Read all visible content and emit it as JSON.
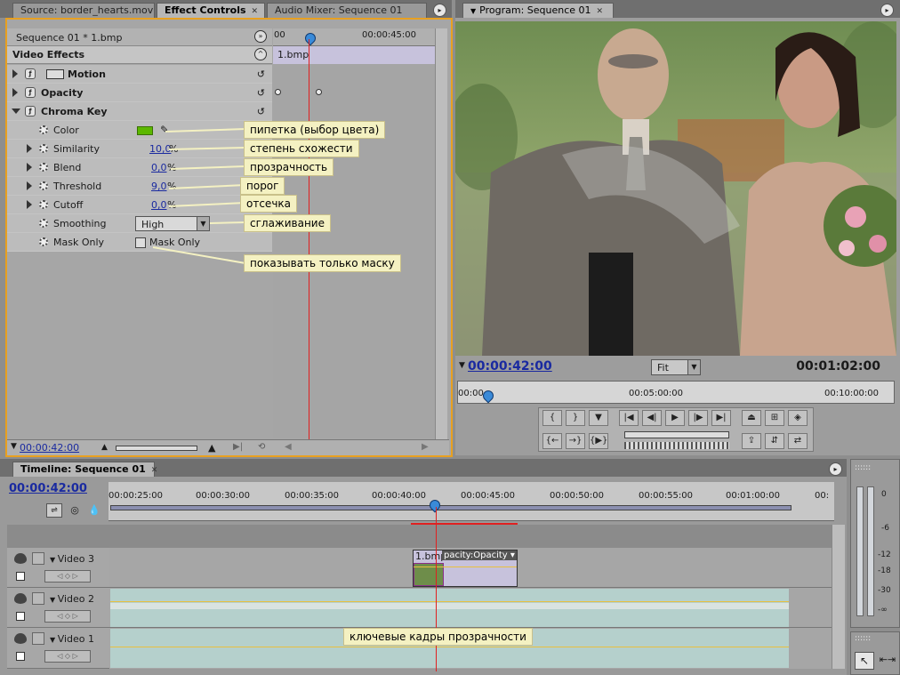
{
  "colors": {
    "accent_border": "#e8a020",
    "playhead": "#e02020",
    "timecode_blue": "#1a2aa0",
    "color_swatch": "#5cb800",
    "callout_bg": "#f4f1c2",
    "clip_teal": "#b5d0cc",
    "clip_lavender": "#c7c2dc"
  },
  "left_tabs": [
    {
      "label": "Source: border_hearts.mov"
    },
    {
      "label": "Effect Controls",
      "active": true
    },
    {
      "label": "Audio Mixer: Sequence 01"
    }
  ],
  "effect_controls": {
    "sequence_label": "Sequence 01 * 1.bmp",
    "section_title": "Video Effects",
    "timeline_start": "00",
    "timeline_mark": "00:00:45:00",
    "clip_name": "1.bmp",
    "footer_timecode": "00:00:42:00",
    "effects": [
      {
        "name": "Motion",
        "icon": "motion-icon"
      },
      {
        "name": "Opacity"
      },
      {
        "name": "Chroma Key"
      }
    ],
    "properties": [
      {
        "name": "Color"
      },
      {
        "name": "Similarity",
        "value": "10,0",
        "unit": "%"
      },
      {
        "name": "Blend",
        "value": "0,0",
        "unit": "%"
      },
      {
        "name": "Threshold",
        "value": "9,0",
        "unit": "%"
      },
      {
        "name": "Cutoff",
        "value": "0,0",
        "unit": "%"
      },
      {
        "name": "Smoothing",
        "value": "High"
      },
      {
        "name": "Mask Only",
        "checkbox_label": "Mask Only"
      }
    ]
  },
  "callouts": {
    "color": "пипетка (выбор цвета)",
    "similarity": "степень схожести",
    "blend": "прозрачность",
    "threshold": "порог",
    "cutoff": "отсечка",
    "smoothing": "сглаживание",
    "mask": "показывать только маску",
    "keyframes": "ключевые кадры прозрачности"
  },
  "program": {
    "tab_label": "Program: Sequence 01",
    "current_timecode": "00:00:42:00",
    "fit_label": "Fit",
    "duration": "00:01:02:00",
    "ruler": [
      "00:00",
      "00:05:00:00",
      "00:10:00:00"
    ]
  },
  "timeline": {
    "tab_label": "Timeline: Sequence 01",
    "current_timecode": "00:00:42:00",
    "ruler": [
      "00:00:25:00",
      "00:00:30:00",
      "00:00:35:00",
      "00:00:40:00",
      "00:00:45:00",
      "00:00:50:00",
      "00:00:55:00",
      "00:01:00:00",
      "00:"
    ],
    "tracks": [
      {
        "name": "Video 3"
      },
      {
        "name": "Video 2"
      },
      {
        "name": "Video 1"
      }
    ],
    "clip": {
      "name": "1.bmp",
      "effect_label": "pacity:Opacity ▾"
    }
  },
  "audio_meter": {
    "scale": [
      "0",
      "-6",
      "-12",
      "-18",
      "-30",
      "-∞"
    ]
  }
}
